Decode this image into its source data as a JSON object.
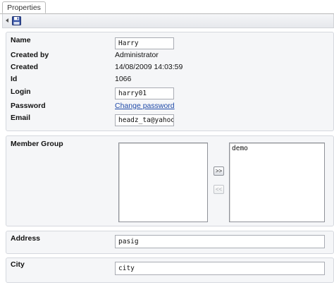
{
  "tabs": [
    {
      "label": "Properties"
    }
  ],
  "toolbar": {
    "save_icon": "save-icon",
    "grip_icon": "grip-icon"
  },
  "properties": {
    "name_label": "Name",
    "name_value": "Harry",
    "created_by_label": "Created by",
    "created_by_value": "Administrator",
    "created_label": "Created",
    "created_value": "14/08/2009 14:03:59",
    "id_label": "Id",
    "id_value": "1066",
    "login_label": "Login",
    "login_value": "harry01",
    "password_label": "Password",
    "password_link": "Change password",
    "email_label": "Email",
    "email_value": "headz_ta@yahoo.com"
  },
  "member_group": {
    "label": "Member Group",
    "available": [],
    "selected": [
      "demo"
    ],
    "add_label": ">>",
    "remove_label": "<<"
  },
  "address": {
    "label": "Address",
    "value": "pasig"
  },
  "city": {
    "label": "City",
    "value": "city"
  },
  "colors": {
    "link": "#1f4aa8",
    "panel_bg": "#f5f6f8",
    "panel_border": "#d5d8de"
  }
}
